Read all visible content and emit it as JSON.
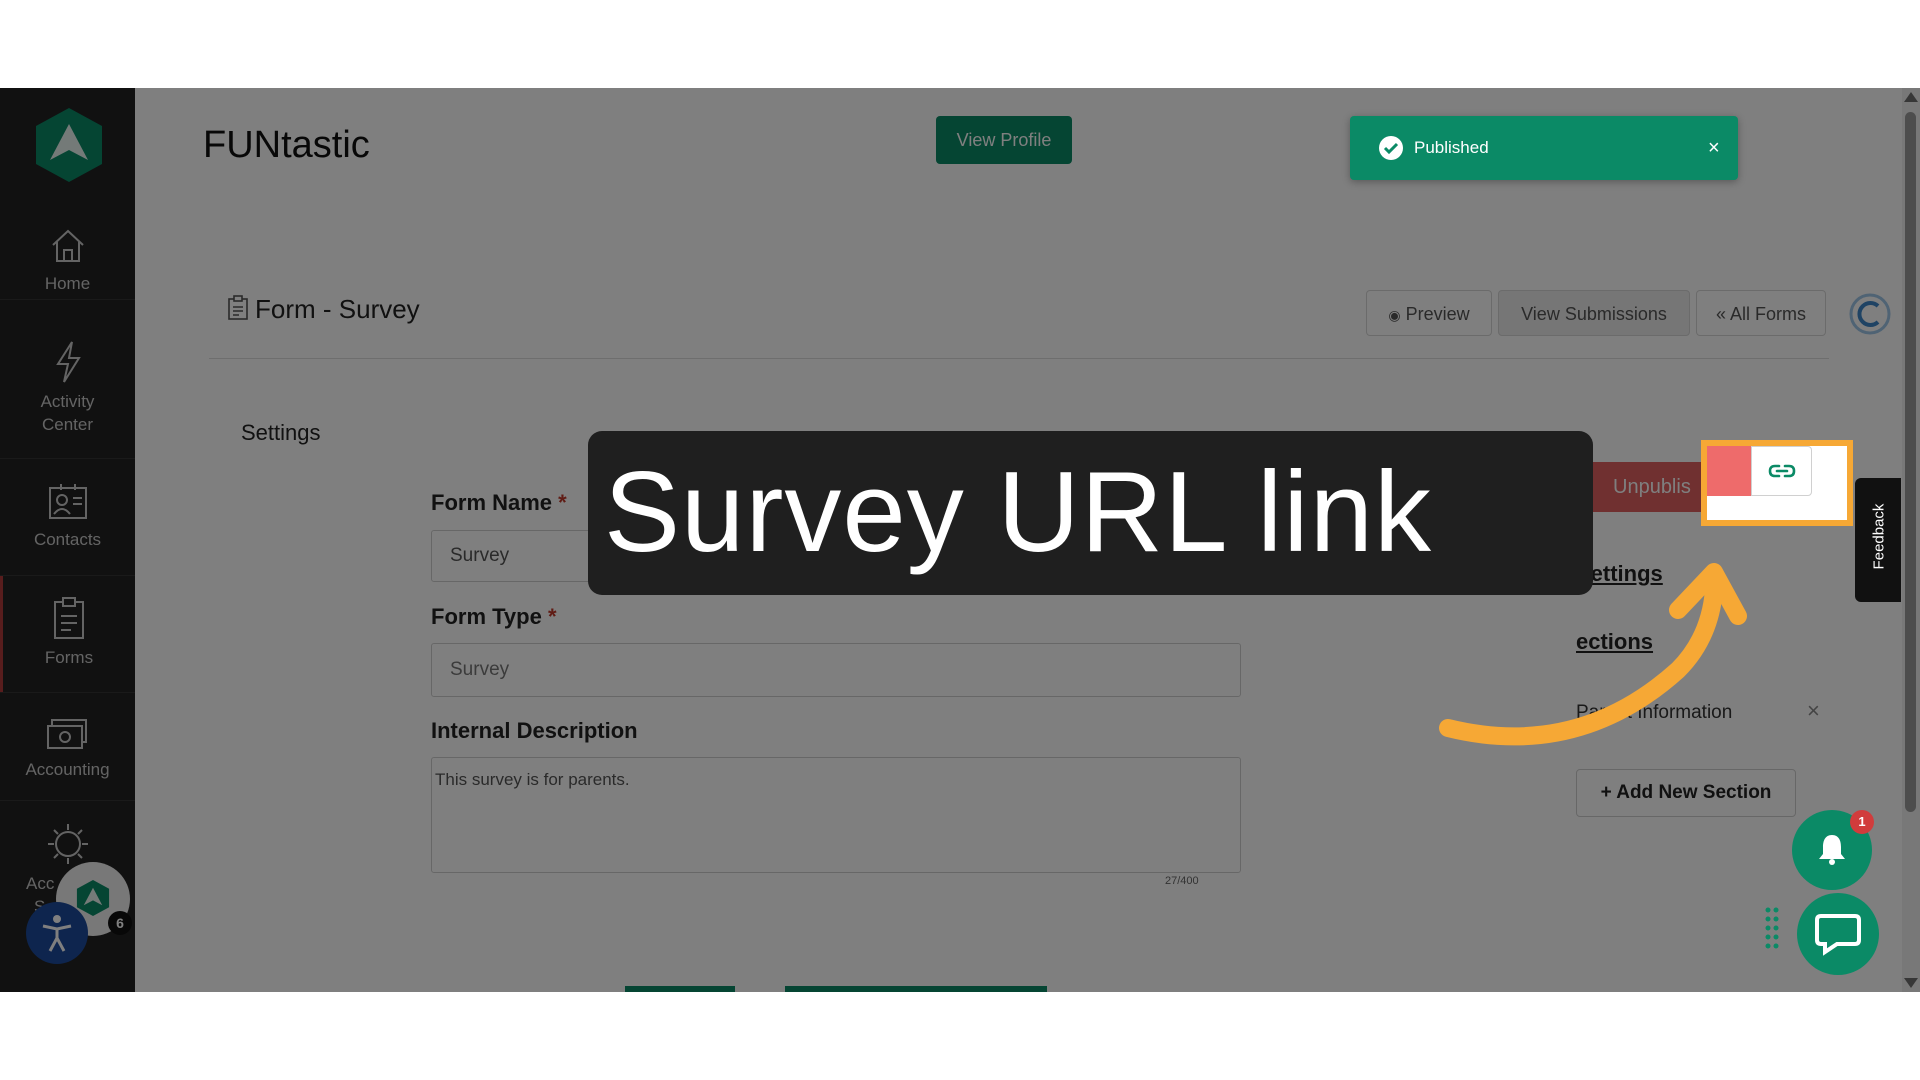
{
  "sidebar": {
    "items": [
      {
        "label": "Home",
        "icon": "home-icon"
      },
      {
        "label": "Activity\nCenter",
        "label_line1": "Activity",
        "label_line2": "Center",
        "icon": "lightning-icon"
      },
      {
        "label": "Contacts",
        "icon": "contacts-icon"
      },
      {
        "label": "Forms",
        "icon": "clipboard-icon"
      },
      {
        "label": "Accounting",
        "icon": "money-icon"
      },
      {
        "label_line1": "Acc",
        "label_line2": "S",
        "icon": "gear-icon"
      }
    ],
    "badge_count": "6"
  },
  "header": {
    "title": "FUNtastic",
    "view_profile": "View Profile"
  },
  "toast": {
    "text": "Published",
    "close": "×"
  },
  "form": {
    "title": "Form - Survey",
    "buttons": {
      "preview": "Preview",
      "view_submissions": "View Submissions",
      "all_forms": "« All Forms"
    },
    "settings_heading": "Settings",
    "fields": {
      "form_name_label": "Form Name",
      "form_name_value": "Survey",
      "form_type_label": "Form Type",
      "form_type_value": "Survey",
      "description_label": "Internal Description",
      "description_value": "This survey is for parents.",
      "char_count": "27/400",
      "required_mark": "*"
    }
  },
  "right_panel": {
    "unpublish": "Unpublis",
    "settings_link": "Settings",
    "sections_link": "ections",
    "section_item": "Parent Information",
    "section_remove": "×",
    "add_section": "+ Add New Section"
  },
  "feedback_tab": "Feedback",
  "notification_count": "1",
  "callout": {
    "text": "Survey URL link"
  },
  "colors": {
    "brand_green": "#0b8a66",
    "sidebar_bg": "#232323",
    "danger_red": "#e06060",
    "highlight_orange": "#f6a835"
  }
}
